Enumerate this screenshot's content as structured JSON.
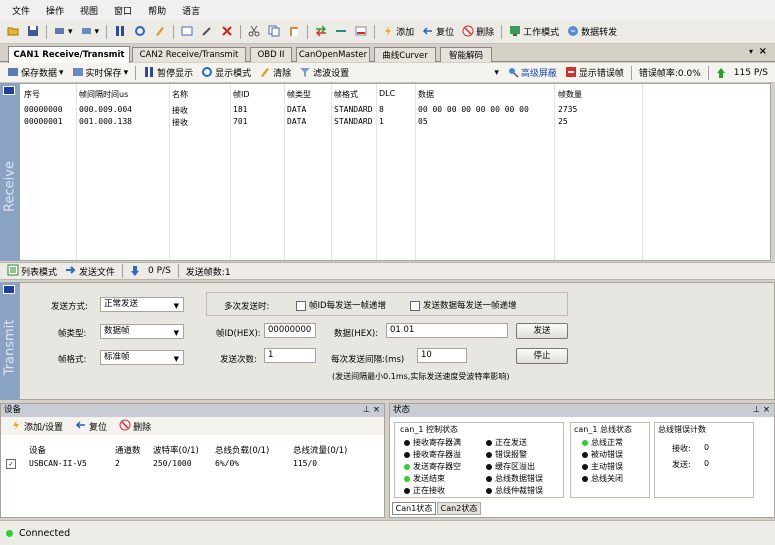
{
  "menu": [
    "文件",
    "操作",
    "视图",
    "窗口",
    "帮助",
    "语言"
  ],
  "toolbar1": {
    "add": "添加",
    "reset": "复位",
    "delete": "删除",
    "work_mode": "工作模式",
    "data_forward": "数据转发"
  },
  "tabs": [
    "CAN1 Receive/Transmit",
    "CAN2 Receive/Transmit",
    "OBD II",
    "CanOpenMaster",
    "曲线Curver",
    "智能解码"
  ],
  "toolbar2": {
    "save_data": "保存数据",
    "realtime_save": "实时保存",
    "pause_display": "暂停显示",
    "display_mode": "显示模式",
    "clear": "清除",
    "filter_settings": "滤波设置",
    "advanced_mask": "高级屏蔽",
    "show_error_frames": "显示错误帧",
    "error_rate": "错误帧率:0.0%",
    "rate": "115 P/S"
  },
  "receive": {
    "side_label": "Receive",
    "headers": [
      "序号",
      "帧间隔时间us",
      "名称",
      "帧ID",
      "帧类型",
      "帧格式",
      "DLC",
      "数据",
      "帧数量"
    ],
    "rows": [
      [
        "00000000",
        "000.009.004",
        "接收",
        "181",
        "DATA",
        "STANDARD",
        "8",
        "00 00 00 00 00 00 00 00",
        "2735"
      ],
      [
        "00000001",
        "001.000.138",
        "接收",
        "701",
        "DATA",
        "STANDARD",
        "1",
        "05",
        "25"
      ]
    ]
  },
  "send_bar": {
    "list_mode": "列表模式",
    "send_file": "发送文件",
    "rate": "0 P/S",
    "sent_count": "发送帧数:1"
  },
  "transmit": {
    "side_label": "Transmit",
    "send_mode_label": "发送方式:",
    "send_mode_value": "正常发送",
    "multi_send_label": "多次发送时:",
    "chk_id_increment": "帧ID每发送一帧递增",
    "chk_data_increment": "发送数据每发送一帧递增",
    "frame_type_label": "帧类型:",
    "frame_type_value": "数据帧",
    "frame_id_label": "帧ID(HEX):",
    "frame_id_value": "00000000",
    "data_label": "数据(HEX):",
    "data_value": "01 01",
    "send_button": "发送",
    "frame_format_label": "帧格式:",
    "frame_format_value": "标准帧",
    "send_count_label": "发送次数:",
    "send_count_value": "1",
    "interval_label": "每次发送间隔:(ms)",
    "interval_value": "10",
    "stop_button": "停止",
    "note": "(发送间隔最小0.1ms,实际发送速度受波特率影响)"
  },
  "device_pane": {
    "title": "设备",
    "add_settings": "添加/设置",
    "reset": "复位",
    "delete": "删除",
    "headers": [
      "设备",
      "通道数",
      "波特率(0/1)",
      "总线负载(0/1)",
      "总线流量(0/1)"
    ],
    "row": [
      "USBCAN-II-V5",
      "2",
      "250/1000",
      "6%/0%",
      "115/0"
    ]
  },
  "status_pane": {
    "title": "状态",
    "control_title": "can_1 控制状态",
    "control_left": [
      {
        "text": "接收寄存器满",
        "on": false
      },
      {
        "text": "接收寄存器溢",
        "on": false
      },
      {
        "text": "发送寄存器空",
        "on": true
      },
      {
        "text": "发送结束",
        "on": true
      },
      {
        "text": "正在接收",
        "on": false
      }
    ],
    "control_right": [
      {
        "text": "正在发送",
        "on": false
      },
      {
        "text": "错误报警",
        "on": false
      },
      {
        "text": "缓存区溢出",
        "on": false
      },
      {
        "text": "总线数据错误",
        "on": false
      },
      {
        "text": "总线仲裁错误",
        "on": false
      }
    ],
    "bus_title": "can_1 总线状态",
    "bus_items": [
      {
        "text": "总线正常",
        "on": true
      },
      {
        "text": "被动错误",
        "on": false
      },
      {
        "text": "主动错误",
        "on": false
      },
      {
        "text": "总线关闭",
        "on": false
      }
    ],
    "err_title": "总线错误计数",
    "recv_label": "接收:",
    "recv_value": "0",
    "send_label": "发送:",
    "send_value": "0",
    "tabs": [
      "Can1状态",
      "Can2状态"
    ]
  },
  "statusbar": {
    "text": "Connected",
    "color": "#2fcf2f"
  }
}
